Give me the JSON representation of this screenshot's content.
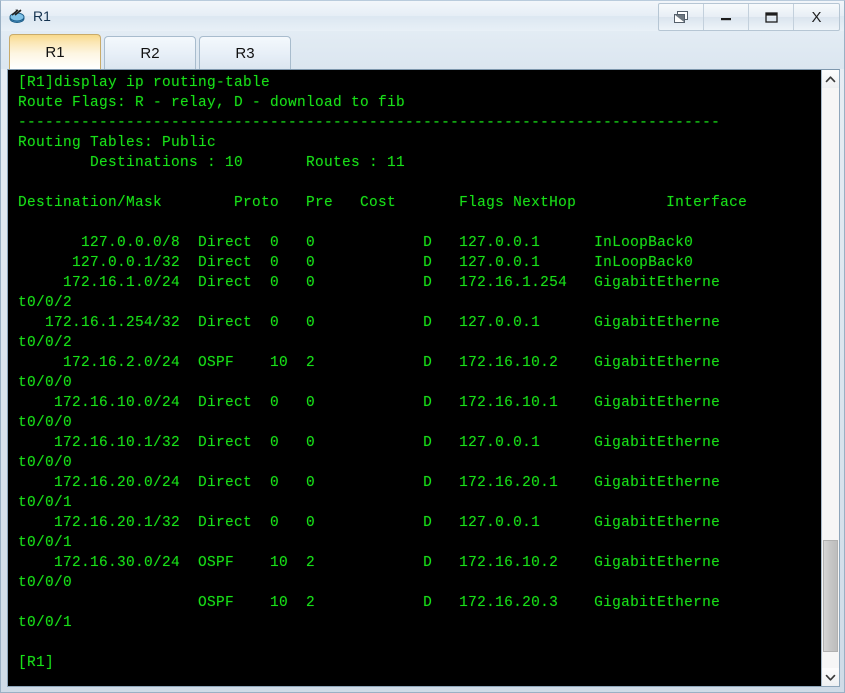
{
  "window": {
    "title": "R1",
    "app_icon": "router-icon",
    "controls": [
      {
        "name": "restore-window-button",
        "icon": "restore-icon",
        "label": ""
      },
      {
        "name": "minimize-button",
        "icon": "minimize-icon",
        "label": ""
      },
      {
        "name": "maximize-button",
        "icon": "maximize-icon",
        "label": ""
      },
      {
        "name": "close-button",
        "icon": "close-icon",
        "label": "X"
      }
    ]
  },
  "tabs": [
    {
      "label": "R1",
      "active": true
    },
    {
      "label": "R2",
      "active": false
    },
    {
      "label": "R3",
      "active": false
    }
  ],
  "terminal": {
    "colors": {
      "background": "#000000",
      "foreground": "#18e018"
    },
    "prompt": "[R1]",
    "command": "display ip routing-table",
    "route_flags_line": "Route Flags: R - relay, D - download to fib",
    "separator": "------------------------------------------------------------------------------",
    "routing_table_label": "Routing Tables: Public",
    "destinations_label": "Destinations",
    "destinations_count": "10",
    "routes_label": "Routes",
    "routes_count": "11",
    "columns": [
      "Destination/Mask",
      "Proto",
      "Pre",
      "Cost",
      "Flags",
      "NextHop",
      "Interface"
    ],
    "routes": [
      {
        "destination": "127.0.0.0/8",
        "proto": "Direct",
        "pre": "0",
        "cost": "0",
        "flags": "D",
        "nexthop": "127.0.0.1",
        "interface": "InLoopBack0"
      },
      {
        "destination": "127.0.0.1/32",
        "proto": "Direct",
        "pre": "0",
        "cost": "0",
        "flags": "D",
        "nexthop": "127.0.0.1",
        "interface": "InLoopBack0"
      },
      {
        "destination": "172.16.1.0/24",
        "proto": "Direct",
        "pre": "0",
        "cost": "0",
        "flags": "D",
        "nexthop": "172.16.1.254",
        "interface": "GigabitEthernet0/0/2"
      },
      {
        "destination": "172.16.1.254/32",
        "proto": "Direct",
        "pre": "0",
        "cost": "0",
        "flags": "D",
        "nexthop": "127.0.0.1",
        "interface": "GigabitEthernet0/0/2"
      },
      {
        "destination": "172.16.2.0/24",
        "proto": "OSPF",
        "pre": "10",
        "cost": "2",
        "flags": "D",
        "nexthop": "172.16.10.2",
        "interface": "GigabitEthernet0/0/0"
      },
      {
        "destination": "172.16.10.0/24",
        "proto": "Direct",
        "pre": "0",
        "cost": "0",
        "flags": "D",
        "nexthop": "172.16.10.1",
        "interface": "GigabitEthernet0/0/0"
      },
      {
        "destination": "172.16.10.1/32",
        "proto": "Direct",
        "pre": "0",
        "cost": "0",
        "flags": "D",
        "nexthop": "127.0.0.1",
        "interface": "GigabitEthernet0/0/0"
      },
      {
        "destination": "172.16.20.0/24",
        "proto": "Direct",
        "pre": "0",
        "cost": "0",
        "flags": "D",
        "nexthop": "172.16.20.1",
        "interface": "GigabitEthernet0/0/1"
      },
      {
        "destination": "172.16.20.1/32",
        "proto": "Direct",
        "pre": "0",
        "cost": "0",
        "flags": "D",
        "nexthop": "127.0.0.1",
        "interface": "GigabitEthernet0/0/1"
      },
      {
        "destination": "172.16.30.0/24",
        "proto": "OSPF",
        "pre": "10",
        "cost": "2",
        "flags": "D",
        "nexthop": "172.16.10.2",
        "interface": "GigabitEthernet0/0/0"
      },
      {
        "destination": "",
        "proto": "OSPF",
        "pre": "10",
        "cost": "2",
        "flags": "D",
        "nexthop": "172.16.20.3",
        "interface": "GigabitEthernet0/0/1"
      }
    ]
  },
  "scrollbar": {
    "up_arrow": "chevron-up-icon",
    "down_arrow": "chevron-down-icon"
  }
}
